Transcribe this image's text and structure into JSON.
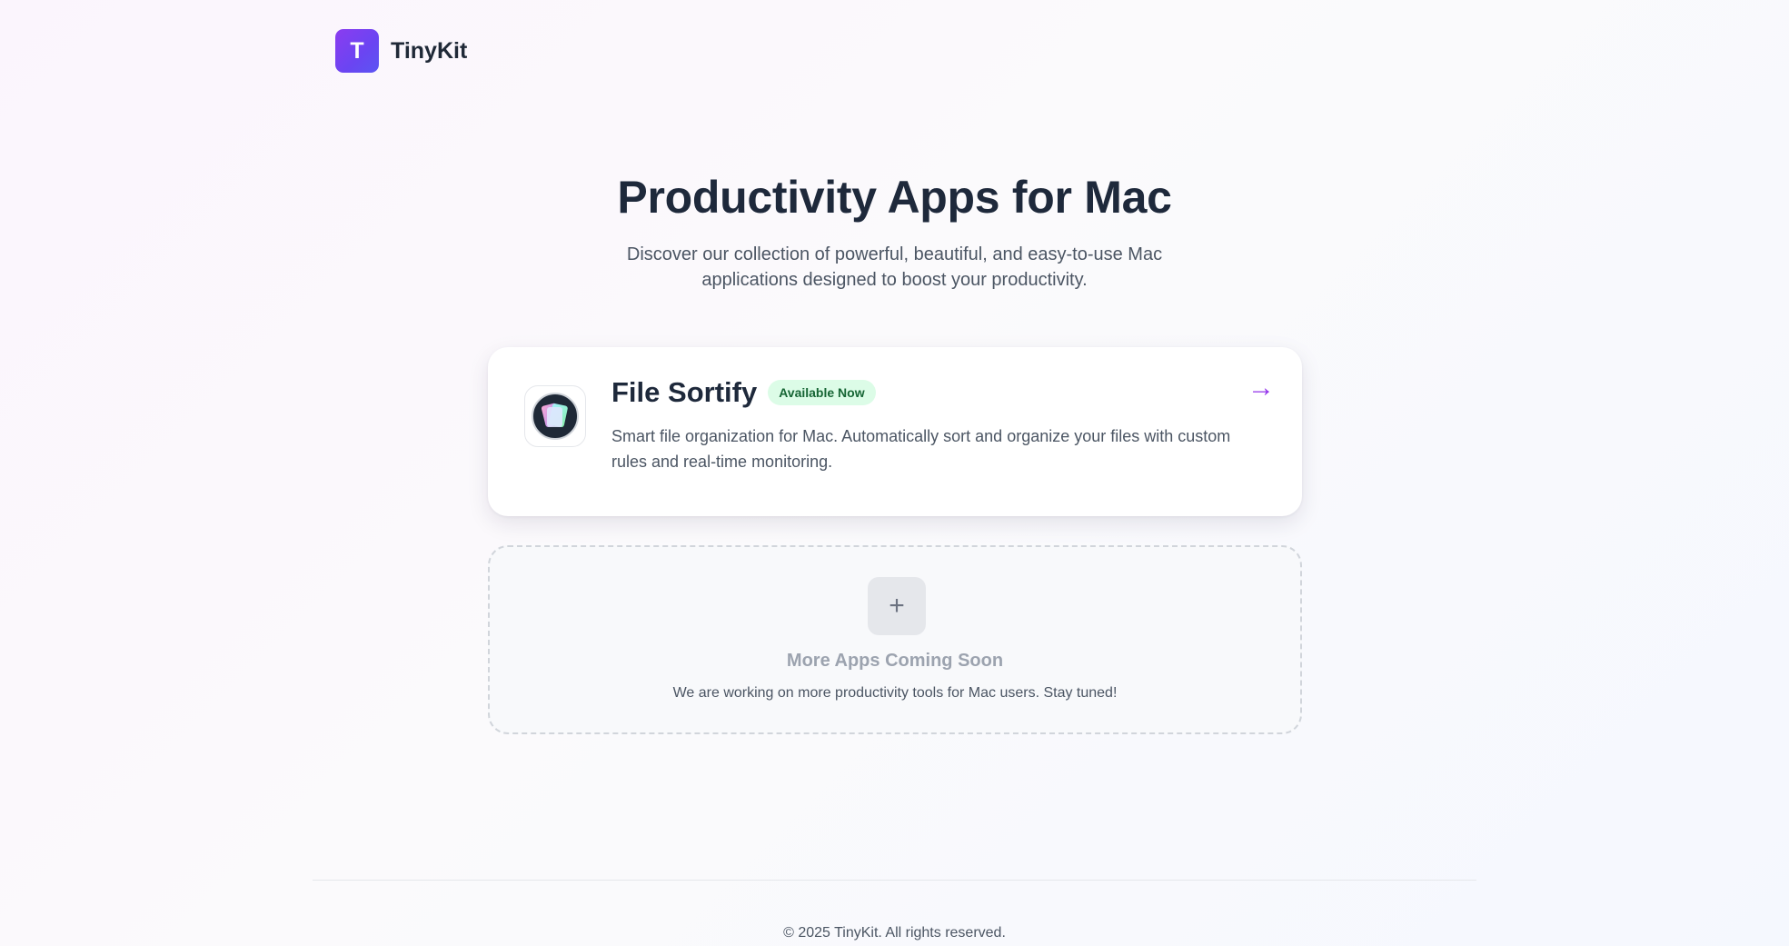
{
  "brand": {
    "logo_letter": "T",
    "name": "TinyKit"
  },
  "hero": {
    "title": "Productivity Apps for Mac",
    "subtitle": "Discover our collection of powerful, beautiful, and easy-to-use Mac applications designed to boost your productivity."
  },
  "apps": [
    {
      "name": "File Sortify",
      "badge": "Available Now",
      "description": "Smart file organization for Mac. Automatically sort and organize your files with custom rules and real-time monitoring.",
      "icon": "file-sortify-app-icon",
      "arrow": "→"
    }
  ],
  "coming_soon": {
    "icon_glyph": "+",
    "title": "More Apps Coming Soon",
    "description": "We are working on more productivity tools for Mac users. Stay tuned!"
  },
  "footer": {
    "copyright": "© 2025 TinyKit. All rights reserved."
  },
  "colors": {
    "brand_gradient_start": "#8b3cf0",
    "brand_gradient_end": "#5b55f3",
    "accent_arrow": "#9333ea",
    "badge_bg": "#dcfce7",
    "badge_text": "#166534"
  }
}
